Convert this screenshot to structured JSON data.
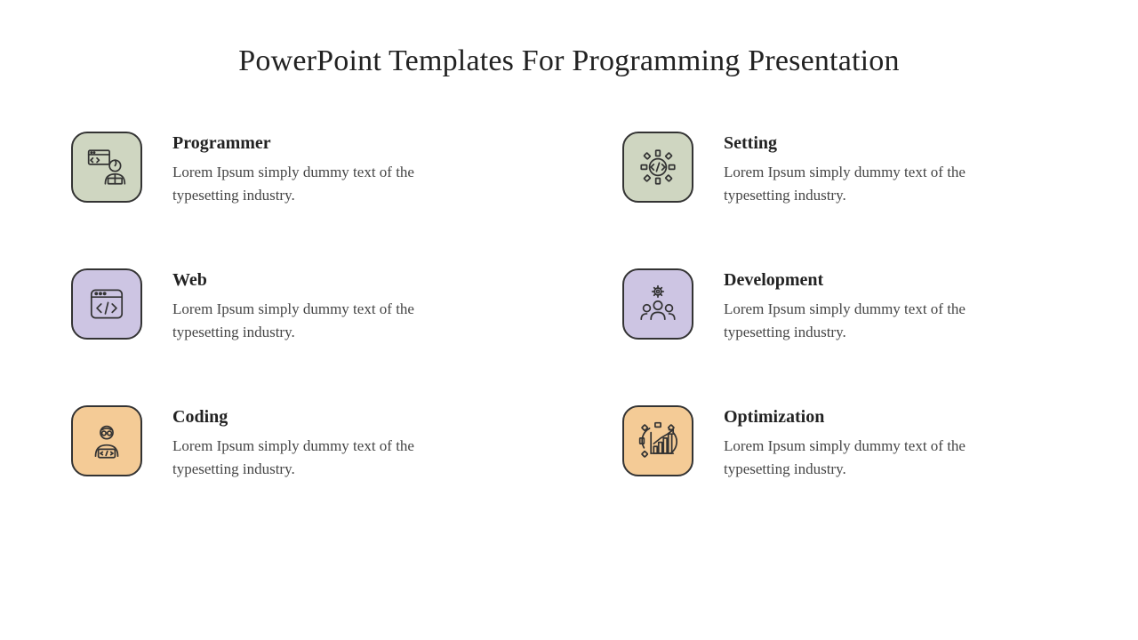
{
  "title": "PowerPoint Templates For Programming Presentation",
  "colors": {
    "green": "#cfd6c1",
    "purple": "#cdc5e3",
    "orange": "#f4cb96"
  },
  "items": [
    {
      "icon": "programmer",
      "color": "green",
      "title": "Programmer",
      "desc": "Lorem Ipsum simply dummy text of the typesetting industry."
    },
    {
      "icon": "setting",
      "color": "green",
      "title": "Setting",
      "desc": "Lorem Ipsum simply dummy text of the typesetting industry."
    },
    {
      "icon": "web",
      "color": "purple",
      "title": "Web",
      "desc": "Lorem Ipsum simply dummy text of the typesetting industry."
    },
    {
      "icon": "development",
      "color": "purple",
      "title": "Development",
      "desc": "Lorem Ipsum simply dummy text of the typesetting industry."
    },
    {
      "icon": "coding",
      "color": "orange",
      "title": "Coding",
      "desc": "Lorem Ipsum simply dummy text of the typesetting industry."
    },
    {
      "icon": "optimization",
      "color": "orange",
      "title": "Optimization",
      "desc": "Lorem Ipsum simply dummy text of the typesetting industry."
    }
  ]
}
